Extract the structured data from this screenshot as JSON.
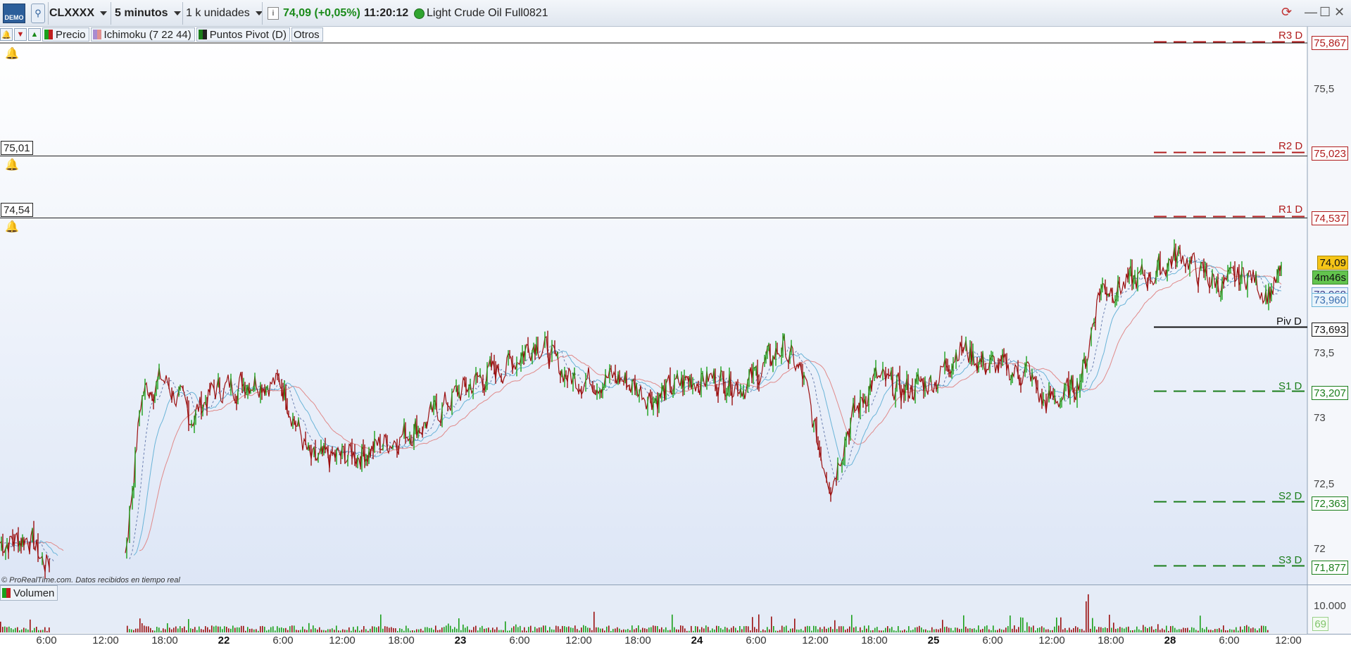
{
  "toolbar": {
    "demo_badge": "DEMO",
    "symbol": "CLXXXX",
    "timeframe": "5 minutos",
    "units": "1 k unidades",
    "last_price": "74,09",
    "change": "(+0,05%)",
    "time": "11:20:12",
    "instrument_name": "Light Crude Oil Full0821"
  },
  "indicators": {
    "price_label": "Precio",
    "ichimoku_label": "Ichimoku (7 22 44)",
    "pivot_label": "Puntos Pivot (D)",
    "others_label": "Otros"
  },
  "price_axis": {
    "ticks": [
      "75,5",
      "73,5",
      "73",
      "72,5",
      "72"
    ],
    "current_price": "74,09",
    "countdown": "4m46s",
    "ichimoku_values": [
      "73,968",
      "73,960"
    ]
  },
  "pivots": [
    {
      "name": "R3 D",
      "value": "75,867"
    },
    {
      "name": "R2 D",
      "value": "75,023"
    },
    {
      "name": "R1 D",
      "value": "74,537"
    },
    {
      "name": "Piv D",
      "value": "73,693"
    },
    {
      "name": "S1 D",
      "value": "73,207"
    },
    {
      "name": "S2 D",
      "value": "72,363"
    },
    {
      "name": "S3 D",
      "value": "71,877"
    }
  ],
  "horizontal_lines": [
    "75,01",
    "74,54"
  ],
  "copyright": "© ProRealTime.com. Datos recibidos en tiempo real",
  "volume": {
    "label": "Volumen",
    "tick": "10.000",
    "last": "69"
  },
  "time_axis": [
    "6:00",
    "12:00",
    "18:00",
    "22",
    "6:00",
    "12:00",
    "18:00",
    "23",
    "6:00",
    "12:00",
    "18:00",
    "24",
    "6:00",
    "12:00",
    "18:00",
    "25",
    "6:00",
    "12:00",
    "18:00",
    "28",
    "6:00",
    "12:00"
  ],
  "colors": {
    "up": "#1aa01a",
    "down": "#9b1010",
    "resistance": "#b01c1c",
    "support": "#1a7d1a",
    "tenkan": "#6ab4d8",
    "kijun": "#e08a8a",
    "price_highlight": "#f5c518",
    "countdown_bg": "#63c44e"
  }
}
